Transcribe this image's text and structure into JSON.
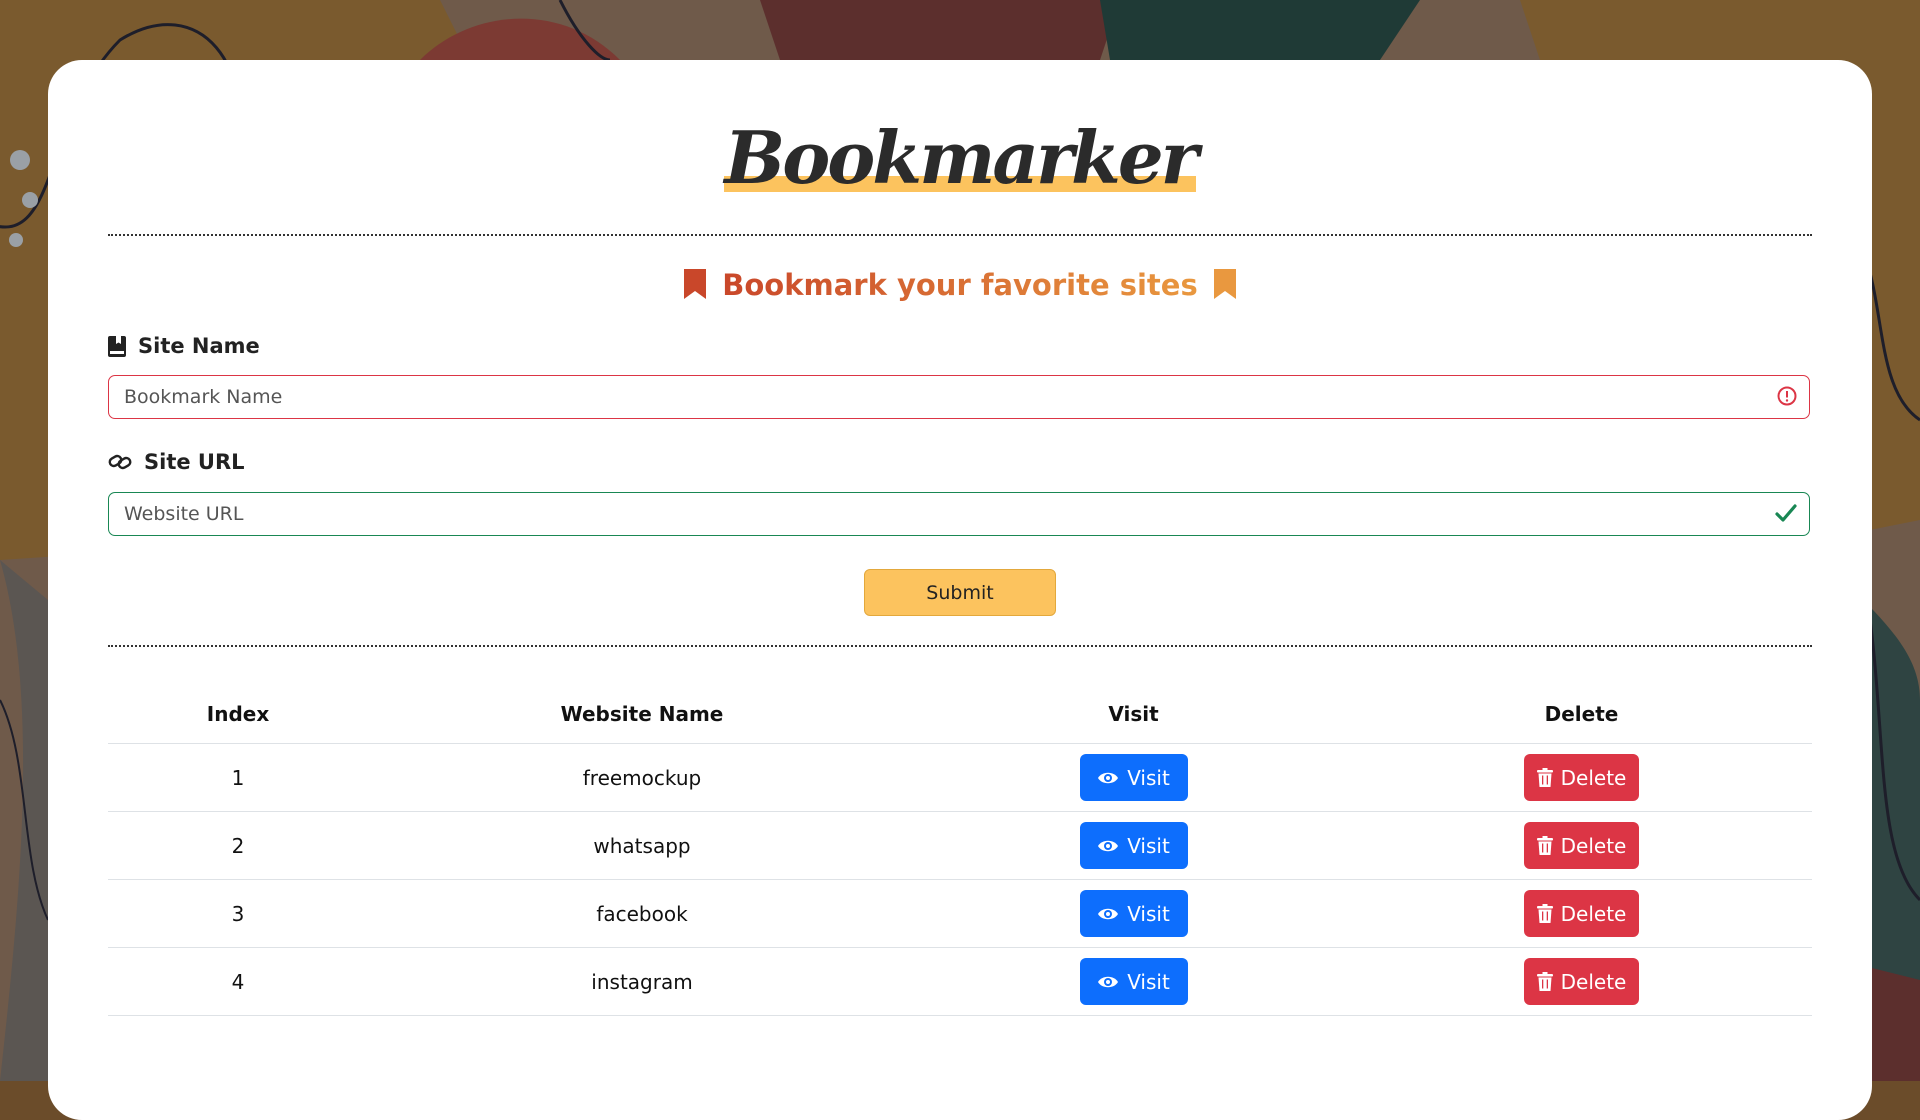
{
  "app": {
    "logo": "Bookmarker",
    "subtitle": "Bookmark your favorite sites"
  },
  "form": {
    "site_name_label": "Site Name",
    "site_name_placeholder": "Bookmark Name",
    "site_url_label": "Site URL",
    "site_url_placeholder": "Website URL",
    "submit_label": "Submit"
  },
  "table": {
    "headers": [
      "Index",
      "Website Name",
      "Visit",
      "Delete"
    ],
    "rows": [
      {
        "index": "1",
        "name": "freemockup",
        "visit": "Visit",
        "delete": "Delete"
      },
      {
        "index": "2",
        "name": "whatsapp",
        "visit": "Visit",
        "delete": "Delete"
      },
      {
        "index": "3",
        "name": "facebook",
        "visit": "Visit",
        "delete": "Delete"
      },
      {
        "index": "4",
        "name": "instagram",
        "visit": "Visit",
        "delete": "Delete"
      }
    ]
  },
  "icons": {
    "subtitle": "bookmark-icon",
    "site_name": "book-bookmark-icon",
    "site_url": "link-icon",
    "invalid": "exclamation-circle-icon",
    "valid": "check-icon",
    "visit": "eye-icon",
    "delete": "trash-icon"
  },
  "colors": {
    "accent": "#fcc35e",
    "invalid": "#dc3545",
    "valid": "#198754",
    "visit_button": "#0d6efd",
    "delete_button": "#dc3545"
  }
}
